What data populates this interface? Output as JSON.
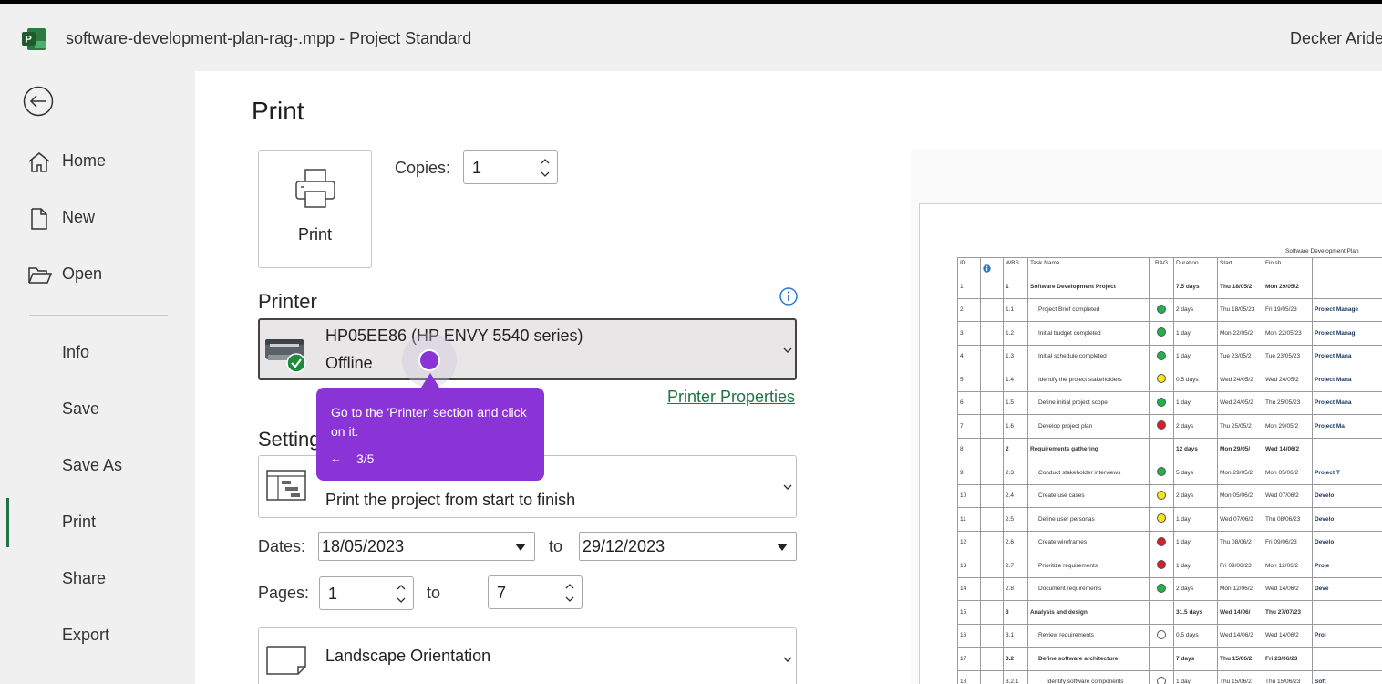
{
  "titlebar": {
    "document_title": "software-development-plan-rag-.mpp  -  Project Standard",
    "user_name": "Decker Aride",
    "app_icon": "project-logo-icon"
  },
  "sidebar": {
    "back_icon": "back-arrow-icon",
    "items": [
      {
        "label": "Home",
        "icon": "home-icon"
      },
      {
        "label": "New",
        "icon": "new-document-icon"
      },
      {
        "label": "Open",
        "icon": "open-folder-icon"
      },
      {
        "label": "Info"
      },
      {
        "label": "Save"
      },
      {
        "label": "Save As"
      },
      {
        "label": "Print",
        "active": true
      },
      {
        "label": "Share"
      },
      {
        "label": "Export"
      }
    ]
  },
  "print": {
    "title": "Print",
    "print_button_label": "Print",
    "copies_label": "Copies:",
    "copies_value": "1",
    "printer_heading": "Printer",
    "printer_name": "HP05EE86 (HP ENVY 5540 series)",
    "printer_status": "Offline",
    "printer_properties_link": "Printer Properties",
    "settings_heading": "Settings",
    "settings_range_description": "Print the project from start to finish",
    "dates_label": "Dates:",
    "date_from": "18/05/2023",
    "date_to_label": "to",
    "date_to": "29/12/2023",
    "pages_label": "Pages:",
    "page_from": "1",
    "page_to_label": "to",
    "page_to": "7",
    "orientation": "Landscape Orientation"
  },
  "tooltip": {
    "text": "Go to the 'Printer' section and click on it.",
    "back": "←",
    "step": "3/5"
  },
  "preview": {
    "report_title": "Software Development Plan",
    "columns": [
      "ID",
      "",
      "WBS",
      "Task Name",
      "RAG",
      "Duration",
      "Start",
      "Finish"
    ],
    "rows": [
      {
        "id": "1",
        "wbs": "1",
        "name": "Software Development Project",
        "rag": "",
        "duration": "7.5 days",
        "start": "Thu 18/05/2",
        "finish": "Mon 29/05/2",
        "bold": true,
        "level": 0,
        "bar": ""
      },
      {
        "id": "2",
        "wbs": "1.1",
        "name": "Project Brief completed",
        "rag": "green",
        "duration": "2 days",
        "start": "Thu 18/05/23",
        "finish": "Fri 19/05/23",
        "bold": false,
        "level": 1,
        "bar": "Project Manage"
      },
      {
        "id": "3",
        "wbs": "1.2",
        "name": "Initial budget completed",
        "rag": "green",
        "duration": "1 day",
        "start": "Mon 22/05/2",
        "finish": "Mon 22/05/23",
        "bold": false,
        "level": 1,
        "bar": "Project Manag"
      },
      {
        "id": "4",
        "wbs": "1.3",
        "name": "Initial schedule completed",
        "rag": "green",
        "duration": "1 day",
        "start": "Tue 23/05/2",
        "finish": "Tue 23/05/23",
        "bold": false,
        "level": 1,
        "bar": "Project Mana"
      },
      {
        "id": "5",
        "wbs": "1.4",
        "name": "Identify the project stakeholders",
        "rag": "yellow",
        "duration": "0.5 days",
        "start": "Wed 24/05/2",
        "finish": "Wed 24/05/2",
        "bold": false,
        "level": 1,
        "bar": "Project Mana"
      },
      {
        "id": "6",
        "wbs": "1.5",
        "name": "Define initial project scope",
        "rag": "green",
        "duration": "1 day",
        "start": "Wed 24/05/2",
        "finish": "Thu 25/05/23",
        "bold": false,
        "level": 1,
        "bar": "Project Mana"
      },
      {
        "id": "7",
        "wbs": "1.6",
        "name": "Develop project plan",
        "rag": "red",
        "duration": "2 days",
        "start": "Thu 25/05/2",
        "finish": "Mon 29/05/2",
        "bold": false,
        "level": 1,
        "bar": "Project Ma"
      },
      {
        "id": "8",
        "wbs": "2",
        "name": "Requirements gathering",
        "rag": "",
        "duration": "12 days",
        "start": "Mon 29/05/",
        "finish": "Wed 14/06/2",
        "bold": true,
        "level": 0,
        "bar": ""
      },
      {
        "id": "9",
        "wbs": "2.3",
        "name": "Conduct stakeholder interviews",
        "rag": "green",
        "duration": "5 days",
        "start": "Mon 29/05/2",
        "finish": "Mon 05/06/2",
        "bold": false,
        "level": 1,
        "bar": "Project T"
      },
      {
        "id": "10",
        "wbs": "2.4",
        "name": "Create use cases",
        "rag": "yellow",
        "duration": "2 days",
        "start": "Mon 05/06/2",
        "finish": "Wed 07/06/2",
        "bold": false,
        "level": 1,
        "bar": "Develo"
      },
      {
        "id": "11",
        "wbs": "2.5",
        "name": "Define user personas",
        "rag": "yellow",
        "duration": "1 day",
        "start": "Wed 07/06/2",
        "finish": "Thu 08/06/23",
        "bold": false,
        "level": 1,
        "bar": "Develo"
      },
      {
        "id": "12",
        "wbs": "2.6",
        "name": "Create wireframes",
        "rag": "red",
        "duration": "1 day",
        "start": "Thu 08/06/2",
        "finish": "Fri 09/06/23",
        "bold": false,
        "level": 1,
        "bar": "Develo"
      },
      {
        "id": "13",
        "wbs": "2.7",
        "name": "Prioritize requirements",
        "rag": "red",
        "duration": "1 day",
        "start": "Fri 09/06/23",
        "finish": "Mon 12/06/2",
        "bold": false,
        "level": 1,
        "bar": "Proje"
      },
      {
        "id": "14",
        "wbs": "2.8",
        "name": "Document requirements",
        "rag": "green",
        "duration": "2 days",
        "start": "Mon 12/06/2",
        "finish": "Wed 14/06/2",
        "bold": false,
        "level": 1,
        "bar": "Deve"
      },
      {
        "id": "15",
        "wbs": "3",
        "name": "Analysis and design",
        "rag": "",
        "duration": "31.5 days",
        "start": "Wed 14/06/",
        "finish": "Thu 27/07/23",
        "bold": true,
        "level": 0,
        "bar": ""
      },
      {
        "id": "16",
        "wbs": "3.1",
        "name": "Review requirements",
        "rag": "white",
        "duration": "0.5 days",
        "start": "Wed 14/06/2",
        "finish": "Wed 14/06/2",
        "bold": false,
        "level": 1,
        "bar": "Proj"
      },
      {
        "id": "17",
        "wbs": "3.2",
        "name": "Define software architecture",
        "rag": "",
        "duration": "7 days",
        "start": "Thu 15/06/2",
        "finish": "Fri 23/06/23",
        "bold": true,
        "level": 1,
        "bar": ""
      },
      {
        "id": "18",
        "wbs": "3.2.1",
        "name": "Identify software components",
        "rag": "white",
        "duration": "1 day",
        "start": "Thu 15/06/2",
        "finish": "Thu 15/06/23",
        "bold": false,
        "level": 2,
        "bar": "Soft"
      }
    ]
  },
  "colors": {
    "accent_green": "#217346",
    "tooltip_purple": "#8a33d6",
    "rag_green": "#22b14c",
    "rag_yellow": "#f5e61a",
    "rag_red": "#d81e2a"
  }
}
